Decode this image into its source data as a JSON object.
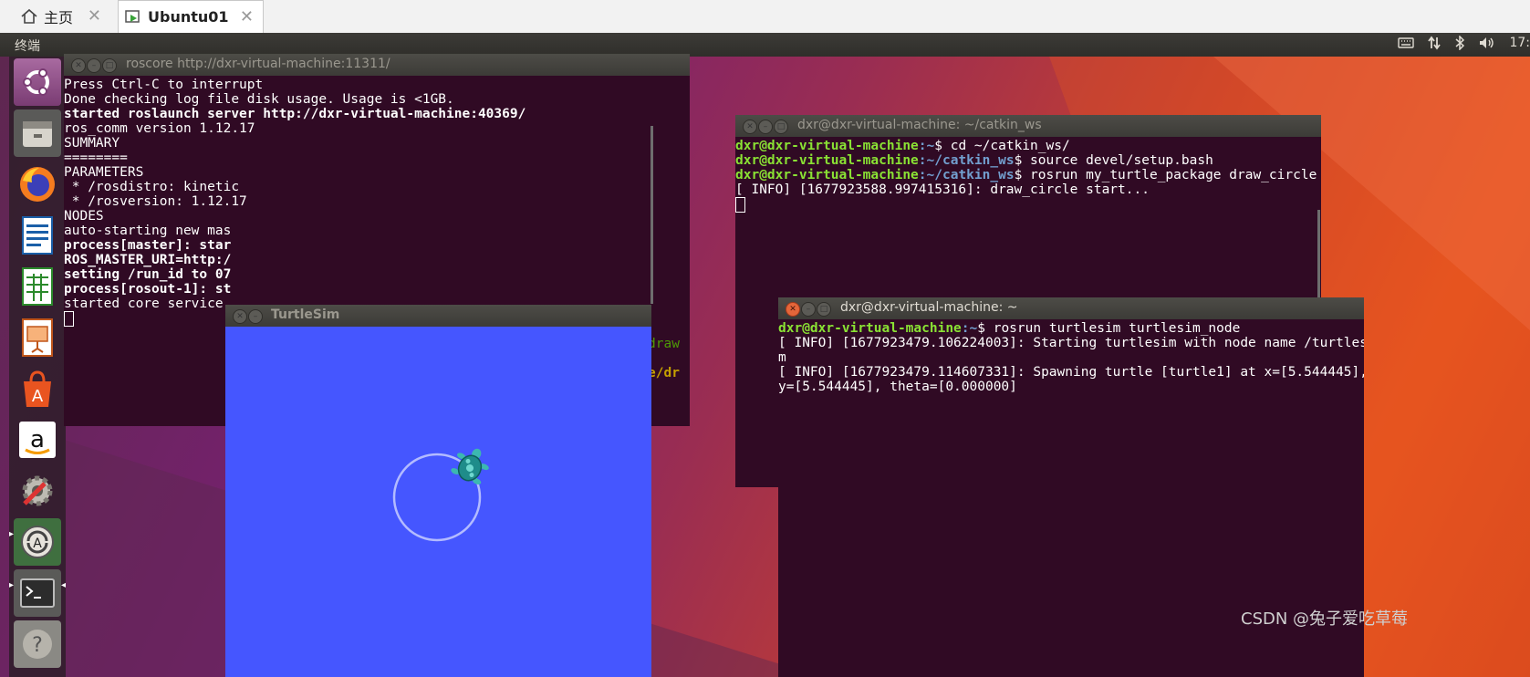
{
  "vm_tabs": [
    {
      "label": "主页",
      "icon": "home-icon"
    },
    {
      "label": "Ubuntu01",
      "icon": "vm-icon"
    }
  ],
  "topbar": {
    "app_name": "终端",
    "clock": "17:"
  },
  "launcher_icons": [
    "ubuntu-dash-icon",
    "files-icon",
    "firefox-icon",
    "writer-icon",
    "calc-icon",
    "impress-icon",
    "software-center-icon",
    "amazon-icon",
    "system-settings-icon",
    "software-updater-icon",
    "terminal-icon",
    "help-icon"
  ],
  "windows": {
    "roscore": {
      "title": "roscore http://dxr-virtual-machine:11311/",
      "lines": [
        "Press Ctrl-C to interrupt",
        "Done checking log file disk usage. Usage is <1GB.",
        "",
        "started roslaunch server http://dxr-virtual-machine:40369/",
        "ros_comm version 1.12.17",
        "",
        "",
        "SUMMARY",
        "========",
        "",
        "PARAMETERS",
        " * /rosdistro: kinetic",
        " * /rosversion: 1.12.17",
        "",
        "NODES",
        "",
        "auto-starting new mas",
        "process[master]: star",
        "ROS_MASTER_URI=http:/",
        "",
        "setting /run_id to 07",
        "process[rosout-1]: st",
        "started core service"
      ],
      "behind_fragments": [
        "draw",
        "e/dr"
      ]
    },
    "catkin": {
      "title": "dxr@dxr-virtual-machine: ~/catkin_ws",
      "user_host": "dxr@dxr-virtual-machine",
      "lines": [
        {
          "path": ":~",
          "cmd": "$ cd ~/catkin_ws/"
        },
        {
          "path": ":~/catkin_ws",
          "cmd": "$ source devel/setup.bash"
        },
        {
          "path": ":~/catkin_ws",
          "cmd": "$ rosrun my_turtle_package draw_circle"
        }
      ],
      "output": "[ INFO] [1677923588.997415316]: draw_circle start..."
    },
    "turtlesim_term": {
      "title": "dxr@dxr-virtual-machine: ~",
      "user_host": "dxr@dxr-virtual-machine",
      "prompt_path": ":~",
      "cmd": "$ rosrun turtlesim turtlesim_node",
      "output": [
        "[ INFO] [1677923479.106224003]: Starting turtlesim with node name /turtlesi",
        "m",
        "[ INFO] [1677923479.114607331]: Spawning turtle [turtle1] at x=[5.544445],",
        "y=[5.544445], theta=[0.000000]"
      ]
    },
    "turtlesim": {
      "title": "TurtleSim",
      "background": "#4556ff"
    }
  },
  "watermark": "CSDN @兔子爱吃草莓"
}
